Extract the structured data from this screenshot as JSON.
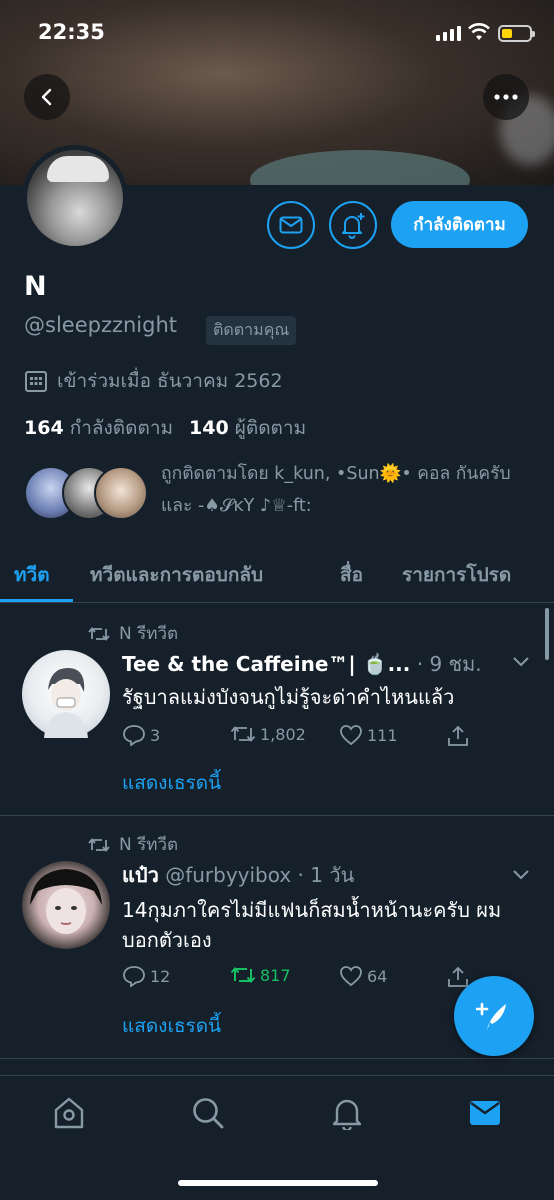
{
  "status_bar": {
    "time": "22:35"
  },
  "profile": {
    "name": "N",
    "handle": "@sleepzznight",
    "follows_you": "ติดตามคุณ",
    "joined": "เข้าร่วมเมื่อ ธันวาคม 2562",
    "following_count": "164",
    "following_label": "กำลังติดตาม",
    "followers_count": "140",
    "followers_label": "ผู้ติดตาม",
    "follow_button": "กำลังติดตาม",
    "followed_by": "ถูกติดตามโดย k_kun, •Sun🌞• คอล กันครับ และ -♠𝓢ᴋY ♪♕-ft:"
  },
  "tabs": [
    {
      "label": "ทวีต"
    },
    {
      "label": "ทวีตและการตอบกลับ"
    },
    {
      "label": "สื่อ"
    },
    {
      "label": "รายการโปรด"
    }
  ],
  "tweets": [
    {
      "retweet_label": "N รีทวีต",
      "name": "Tee & the Caffeine™| 🍵...",
      "meta": "· 9 ชม.",
      "text": "รัฐบาลแม่งบังจนกูไม่รู้จะด่าคำไหนแล้ว",
      "replies": "3",
      "retweets": "1,802",
      "likes": "111",
      "thread_link": "แสดงเธรดนี้"
    },
    {
      "retweet_label": "N รีทวีต",
      "name": "แป๋ว",
      "meta": "@furbyyibox · 1 วัน",
      "text": "14กุมภาใครไม่มีแฟนก็สมน้ำหน้านะครับ ผมบอกตัวเอง",
      "replies": "12",
      "retweets": "817",
      "likes": "64",
      "thread_link": "แสดงเธรดนี้"
    }
  ],
  "colors": {
    "accent": "#1da1f2",
    "background": "#15202b",
    "retweet_green": "#17bf63",
    "muted": "#8899a6"
  },
  "icons": [
    "back-icon",
    "more-icon",
    "mail-icon",
    "bell-plus-icon",
    "calendar-icon",
    "retweet-icon",
    "reply-icon",
    "like-icon",
    "share-icon",
    "chevron-down-icon",
    "compose-icon",
    "home-icon",
    "search-icon",
    "notifications-icon",
    "messages-icon"
  ]
}
